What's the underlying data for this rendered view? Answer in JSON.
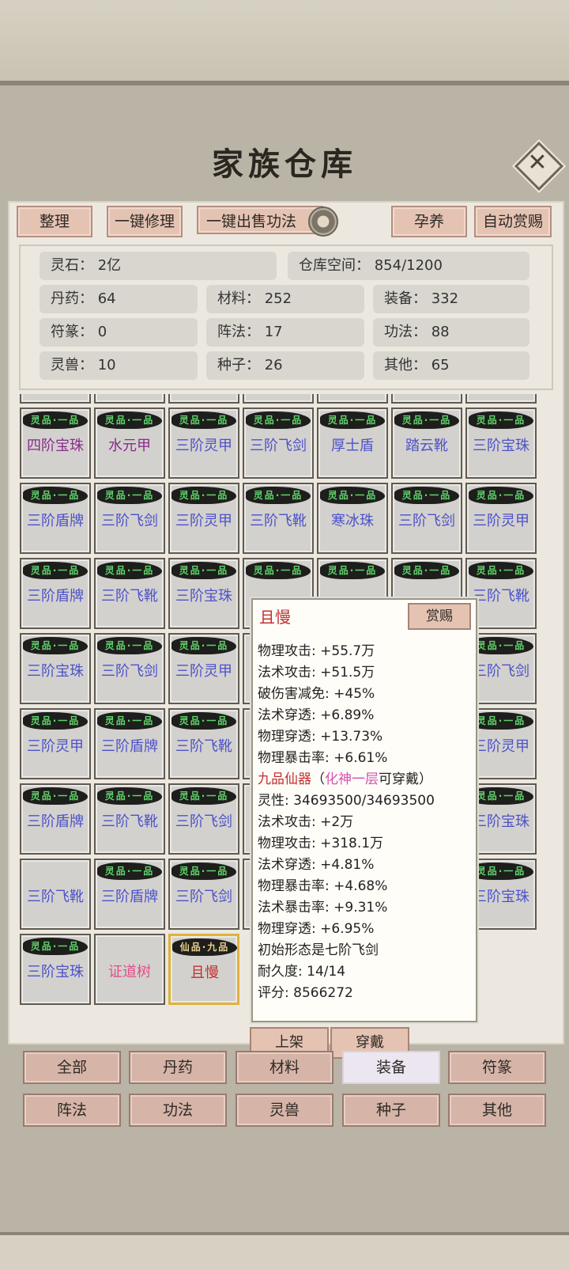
{
  "title": "家族仓库",
  "toolbar": {
    "sort": "整理",
    "repair_all": "一键修理",
    "sell_all_skills": "一键出售功法",
    "nurture": "孕养",
    "auto_reward": "自动赏赐"
  },
  "stats": {
    "spirit_stone": "灵石：  2亿",
    "storage": "仓库空间：    854/1200",
    "pills": "丹药：  64",
    "materials": "材料：  252",
    "equipment": "装备：  332",
    "talismans": "符篆：  0",
    "formations": "阵法：  17",
    "skills": "功法：  88",
    "beasts": "灵兽：  10",
    "seeds": "种子：  26",
    "others": "其他：  65"
  },
  "grid": {
    "rows": [
      [
        {
          "tag": "灵品·一品",
          "name": "四阶宝珠",
          "color": "#8a2a8e"
        },
        {
          "tag": "灵品·一品",
          "name": "水元甲",
          "color": "#8a2a8e"
        },
        {
          "tag": "灵品·一品",
          "name": "三阶灵甲",
          "color": "#4c52c8"
        },
        {
          "tag": "灵品·一品",
          "name": "三阶飞剑",
          "color": "#4c52c8"
        },
        {
          "tag": "灵品·一品",
          "name": "厚士盾",
          "color": "#4c52c8"
        },
        {
          "tag": "灵品·一品",
          "name": "踏云靴",
          "color": "#4c52c8"
        },
        {
          "tag": "灵品·一品",
          "name": "三阶宝珠",
          "color": "#4c52c8"
        }
      ],
      [
        {
          "tag": "灵品·一品",
          "name": "三阶盾牌",
          "color": "#4c52c8"
        },
        {
          "tag": "灵品·一品",
          "name": "三阶飞剑",
          "color": "#4c52c8"
        },
        {
          "tag": "灵品·一品",
          "name": "三阶灵甲",
          "color": "#4c52c8"
        },
        {
          "tag": "灵品·一品",
          "name": "三阶飞靴",
          "color": "#4c52c8"
        },
        {
          "tag": "灵品·一品",
          "name": "寒冰珠",
          "color": "#4c52c8"
        },
        {
          "tag": "灵品·一品",
          "name": "三阶飞剑",
          "color": "#4c52c8"
        },
        {
          "tag": "灵品·一品",
          "name": "三阶灵甲",
          "color": "#4c52c8"
        }
      ],
      [
        {
          "tag": "灵品·一品",
          "name": "三阶盾牌",
          "color": "#4c52c8"
        },
        {
          "tag": "灵品·一品",
          "name": "三阶飞靴",
          "color": "#4c52c8"
        },
        {
          "tag": "灵品·一品",
          "name": "三阶宝珠",
          "color": "#4c52c8"
        },
        {
          "tag": "灵品·一品",
          "name": "",
          "color": "#4c52c8"
        },
        {
          "tag": "灵品·一品",
          "name": "",
          "color": "#4c52c8"
        },
        {
          "tag": "灵品·一品",
          "name": "",
          "color": "#4c52c8"
        },
        {
          "tag": "灵品·一品",
          "name": "三阶飞靴",
          "color": "#4c52c8"
        }
      ],
      [
        {
          "tag": "灵品·一品",
          "name": "三阶宝珠",
          "color": "#4c52c8"
        },
        {
          "tag": "灵品·一品",
          "name": "三阶飞剑",
          "color": "#4c52c8"
        },
        {
          "tag": "灵品·一品",
          "name": "三阶灵甲",
          "color": "#4c52c8"
        },
        {
          "tag": "",
          "name": "",
          "color": "#4c52c8"
        },
        {
          "tag": "",
          "name": "",
          "color": "#4c52c8"
        },
        {
          "tag": "",
          "name": "",
          "color": "#4c52c8"
        },
        {
          "tag": "灵品·一品",
          "name": "三阶飞剑",
          "color": "#4c52c8"
        }
      ],
      [
        {
          "tag": "灵品·一品",
          "name": "三阶灵甲",
          "color": "#4c52c8"
        },
        {
          "tag": "灵品·一品",
          "name": "三阶盾牌",
          "color": "#4c52c8"
        },
        {
          "tag": "灵品·一品",
          "name": "三阶飞靴",
          "color": "#4c52c8"
        },
        {
          "tag": "",
          "name": "",
          "color": "#4c52c8"
        },
        {
          "tag": "",
          "name": "",
          "color": "#4c52c8"
        },
        {
          "tag": "",
          "name": "",
          "color": "#4c52c8"
        },
        {
          "tag": "灵品·一品",
          "name": "三阶灵甲",
          "color": "#4c52c8"
        }
      ],
      [
        {
          "tag": "灵品·一品",
          "name": "三阶盾牌",
          "color": "#4c52c8"
        },
        {
          "tag": "灵品·一品",
          "name": "三阶飞靴",
          "color": "#4c52c8"
        },
        {
          "tag": "灵品·一品",
          "name": "三阶飞剑",
          "color": "#4c52c8"
        },
        {
          "tag": "",
          "name": "",
          "color": "#4c52c8"
        },
        {
          "tag": "",
          "name": "",
          "color": "#4c52c8"
        },
        {
          "tag": "",
          "name": "",
          "color": "#4c52c8"
        },
        {
          "tag": "灵品·一品",
          "name": "三阶宝珠",
          "color": "#4c52c8"
        }
      ],
      [
        {
          "tag": "",
          "name": "三阶飞靴",
          "color": "#4c52c8"
        },
        {
          "tag": "灵品·一品",
          "name": "三阶盾牌",
          "color": "#4c52c8"
        },
        {
          "tag": "灵品·一品",
          "name": "三阶飞剑",
          "color": "#4c52c8"
        },
        {
          "tag": "",
          "name": "",
          "color": "#4c52c8"
        },
        {
          "tag": "",
          "name": "",
          "color": "#4c52c8"
        },
        {
          "tag": "",
          "name": "",
          "color": "#4c52c8"
        },
        {
          "tag": "灵品·一品",
          "name": "三阶宝珠",
          "color": "#4c52c8"
        }
      ],
      [
        {
          "tag": "灵品·一品",
          "name": "三阶宝珠",
          "color": "#4c52c8"
        },
        {
          "tag": "",
          "name": "证道树",
          "color": "#e0508a"
        },
        {
          "tag": "仙品·九品",
          "name": "且慢",
          "color": "#c23030",
          "gold": true,
          "selected": true
        }
      ]
    ]
  },
  "tooltip": {
    "name": "且慢",
    "reward_button": "赏赐",
    "lines": [
      {
        "text": "物理攻击: +55.7万"
      },
      {
        "text": "法术攻击: +51.5万"
      },
      {
        "text": "破伤害减免: +45%"
      },
      {
        "text": "法术穿透: +6.89%"
      },
      {
        "text": "物理穿透: +13.73%"
      },
      {
        "text": "物理暴击率: +6.61%"
      },
      {
        "grade": "九品仙器",
        "paren_open": "（",
        "realm": "化神一层",
        "req": "可穿戴）"
      },
      {
        "text": "灵性:  34693500/34693500"
      },
      {
        "text": "法术攻击: +2万"
      },
      {
        "text": "物理攻击: +318.1万"
      },
      {
        "text": "法术穿透: +4.81%"
      },
      {
        "text": "物理暴击率: +4.68%"
      },
      {
        "text": "法术暴击率: +9.31%"
      },
      {
        "text": "物理穿透: +6.95%"
      },
      {
        "text": "初始形态是七阶飞剑"
      },
      {
        "text": "耐久度:  14/14"
      },
      {
        "text": "评分:  8566272"
      }
    ]
  },
  "actions": {
    "list": "上架",
    "equip": "穿戴"
  },
  "categories": [
    "全部",
    "丹药",
    "材料",
    "装备",
    "符篆",
    "阵法",
    "功法",
    "灵兽",
    "种子",
    "其他"
  ],
  "active_category": "装备"
}
